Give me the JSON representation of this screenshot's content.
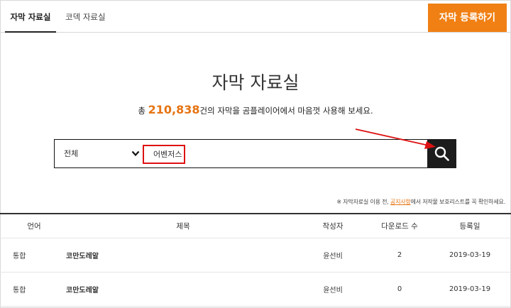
{
  "tabs": [
    {
      "label": "자막 자료실"
    },
    {
      "label": "코덱 자료실"
    }
  ],
  "register_button": "자막 등록하기",
  "page_title": "자막 자료실",
  "subtitle": {
    "prefix": "총 ",
    "count": "210,838",
    "suffix": "건의 자막을 곰플레이어에서 마음껏 사용해 보세요."
  },
  "search": {
    "category_selected": "전체",
    "query": "어벤저스"
  },
  "icons": {
    "search": "search-icon",
    "dropdown": "chevron-down-icon"
  },
  "notice": {
    "prefix": "※ 자막자료실 이용 전, ",
    "link": "공지사항",
    "suffix": "에서 저작물 보호리스트를 꼭 확인하세요."
  },
  "columns": {
    "lang": "언어",
    "title": "제목",
    "author": "작성자",
    "downloads": "다운로드 수",
    "date": "등록일"
  },
  "rows": [
    {
      "lang": "통합",
      "title": "코만도레알",
      "author": "윤선비",
      "downloads": "2",
      "date": "2019-03-19"
    },
    {
      "lang": "통합",
      "title": "코만도레알",
      "author": "윤선비",
      "downloads": "0",
      "date": "2019-03-19"
    }
  ],
  "colors": {
    "accent": "#f08014",
    "highlight_box": "#dd1111",
    "search_button": "#1c1c1c"
  }
}
